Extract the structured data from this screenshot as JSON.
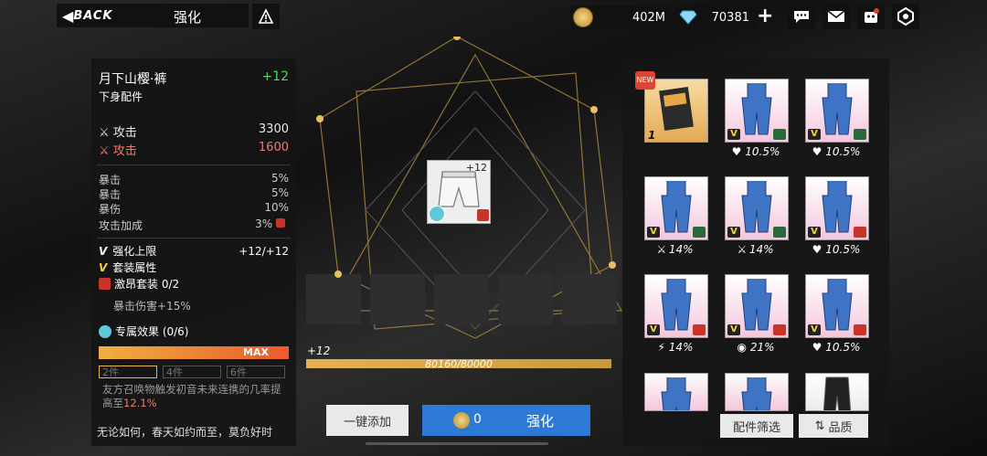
{
  "header": {
    "back_label": "BACK",
    "title": "强化",
    "help_icon": "help-icon",
    "gold": "402M",
    "gems": "70381",
    "plus": "+"
  },
  "item": {
    "name": "月下山樱·裤",
    "level": "+12",
    "slot": "下身配件",
    "stats": [
      {
        "label": "攻击",
        "value": "3300",
        "color": "#ffffff"
      },
      {
        "label": "攻击",
        "value": "1600",
        "color": "#f07a6a"
      }
    ],
    "substats": [
      {
        "label": "暴击",
        "value": "5%"
      },
      {
        "label": "暴击",
        "value": "5%"
      },
      {
        "label": "暴伤",
        "value": "10%"
      },
      {
        "label": "攻击加成",
        "value": "3%"
      }
    ],
    "enhance_cap_label": "强化上限",
    "enhance_cap_value": "+12/+12",
    "set_attr_label": "套装属性",
    "set_name": "激昂套装 0/2",
    "set_bonus": "暴击伤害+15%",
    "exclusive_label": "专属效果 (0/6)",
    "exclusive_fill": 1.0,
    "max_label": "MAX",
    "pieces": [
      "2件",
      "4件",
      "6件"
    ],
    "exclusive_desc_a": "友方召唤物触发初音未来连携的几率提高至",
    "exclusive_desc_b": "12.1%",
    "quote": "无论如何，春天如约而至，莫负好时"
  },
  "center": {
    "card_level": "+12",
    "progress_level": "+12",
    "progress_text": "80160/80000",
    "progress_fill": 1.0,
    "add_button": "一键添加",
    "cost": "0",
    "enhance_button": "强化"
  },
  "inventory": {
    "first_count": "1",
    "new_tag": "NEW",
    "items": [
      {
        "stat": "10.5%",
        "stat_icon": "heart-icon",
        "set": "green"
      },
      {
        "stat": "10.5%",
        "stat_icon": "heart-icon",
        "set": "green"
      },
      {
        "stat": "14%",
        "stat_icon": "sword-icon",
        "set": "green"
      },
      {
        "stat": "14%",
        "stat_icon": "sword-icon",
        "set": "green"
      },
      {
        "stat": "10.5%",
        "stat_icon": "heart-icon",
        "set": "red"
      },
      {
        "stat": "14%",
        "stat_icon": "lightning-icon",
        "set": "red"
      },
      {
        "stat": "21%",
        "stat_icon": "crit-icon",
        "set": "red"
      },
      {
        "stat": "10.5%",
        "stat_icon": "heart-icon",
        "set": "red"
      }
    ],
    "filter_button": "配件筛选",
    "sort_button": "品质"
  }
}
